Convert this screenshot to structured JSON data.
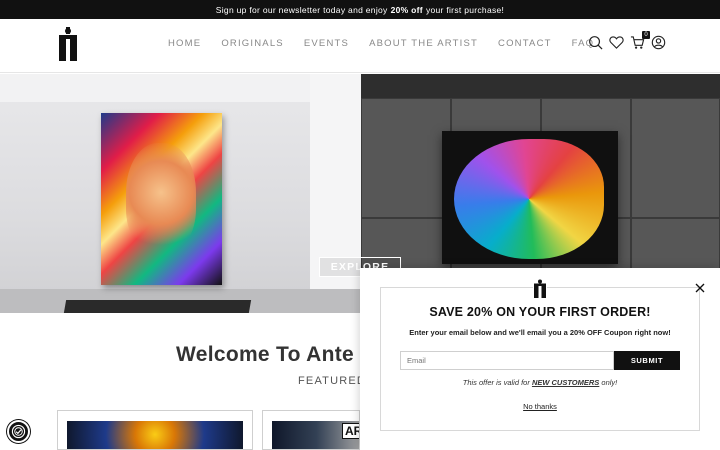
{
  "announcement": {
    "text_before": "Sign up for our newsletter today and enjoy",
    "highlight": "20% off",
    "text_after": "your first purchase!"
  },
  "nav": {
    "items": [
      "HOME",
      "ORIGINALS",
      "EVENTS",
      "ABOUT THE ARTIST",
      "CONTACT",
      "FAQ"
    ]
  },
  "header_icons": {
    "search": "search-icon",
    "wishlist": "heart-icon",
    "cart": "cart-icon",
    "cart_count": "0",
    "account": "user-icon"
  },
  "hero": {
    "button_label": "EXPLORE"
  },
  "welcome": {
    "title": "Welcome To Ante",
    "subtitle": "FEATURED"
  },
  "featured_cards": [
    {
      "badge": ""
    },
    {
      "badge": "AR"
    }
  ],
  "popup": {
    "title": "SAVE 20% ON YOUR FIRST ORDER!",
    "subtitle": "Enter your email below and we'll email you a 20% OFF Coupon right now!",
    "email_placeholder": "Email",
    "submit_label": "SUBMIT",
    "offer_before": "This offer is valid for",
    "offer_highlight": "NEW CUSTOMERS",
    "offer_after": "only!",
    "no_thanks": "No thanks"
  },
  "colors": {
    "dark": "#111111",
    "nav_text": "#888888",
    "border": "#cfcfcf"
  }
}
